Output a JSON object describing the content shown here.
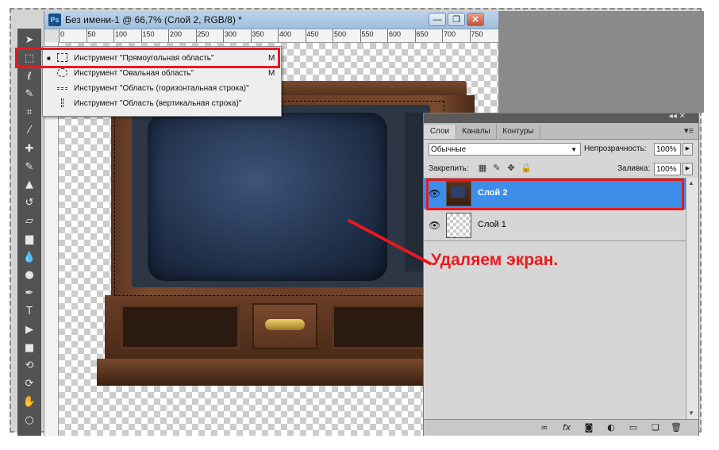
{
  "document": {
    "ps_logo": "Ps",
    "title": "Без имени-1 @ 66,7% (Слой 2, RGB/8) *",
    "ruler_labels": [
      "0",
      "50",
      "100",
      "150",
      "200",
      "250",
      "300",
      "350",
      "400",
      "450",
      "500",
      "550",
      "600",
      "650",
      "700",
      "750"
    ],
    "buttons": {
      "minimize": "—",
      "restore": "❐",
      "close": "✕"
    }
  },
  "flyout": {
    "items": [
      {
        "label": "Инструмент \"Прямоугольная область\"",
        "key": "M",
        "icon": "rect-marquee-icon",
        "active": true
      },
      {
        "label": "Инструмент \"Овальная область\"",
        "key": "M",
        "icon": "ellipse-marquee-icon",
        "active": false
      },
      {
        "label": "Инструмент \"Область (горизонтальная строка)\"",
        "key": "",
        "icon": "single-row-marquee-icon",
        "active": false
      },
      {
        "label": "Инструмент \"Область (вертикальная строка)\"",
        "key": "",
        "icon": "single-column-marquee-icon",
        "active": false
      }
    ]
  },
  "tools": [
    {
      "name": "move-tool-icon",
      "glyph": "➤"
    },
    {
      "name": "marquee-tool-icon",
      "glyph": "⬚"
    },
    {
      "name": "lasso-tool-icon",
      "glyph": "ℓ"
    },
    {
      "name": "quick-selection-tool-icon",
      "glyph": "✎"
    },
    {
      "name": "crop-tool-icon",
      "glyph": "⌗"
    },
    {
      "name": "eyedropper-tool-icon",
      "glyph": "⁄"
    },
    {
      "name": "healing-brush-tool-icon",
      "glyph": "✚"
    },
    {
      "name": "brush-tool-icon",
      "glyph": "✎"
    },
    {
      "name": "clone-stamp-tool-icon",
      "glyph": "▲"
    },
    {
      "name": "history-brush-tool-icon",
      "glyph": "↺"
    },
    {
      "name": "eraser-tool-icon",
      "glyph": "▱"
    },
    {
      "name": "gradient-tool-icon",
      "glyph": "▆"
    },
    {
      "name": "blur-tool-icon",
      "glyph": "💧"
    },
    {
      "name": "dodge-tool-icon",
      "glyph": "●"
    },
    {
      "name": "pen-tool-icon",
      "glyph": "✒"
    },
    {
      "name": "type-tool-icon",
      "glyph": "T"
    },
    {
      "name": "path-selection-tool-icon",
      "glyph": "▶"
    },
    {
      "name": "shape-tool-icon",
      "glyph": "■"
    },
    {
      "name": "3d-rotate-tool-icon",
      "glyph": "⟲"
    },
    {
      "name": "3d-orbit-tool-icon",
      "glyph": "⟳"
    },
    {
      "name": "hand-tool-icon",
      "glyph": "✋"
    },
    {
      "name": "zoom-tool-icon",
      "glyph": "○"
    }
  ],
  "layers_panel": {
    "tabs": [
      "Слои",
      "Каналы",
      "Контуры"
    ],
    "active_tab": "Слои",
    "blend_mode": "Обычные",
    "opacity_label": "Непрозрачность:",
    "opacity_value": "100%",
    "lock_label": "Закрепить:",
    "fill_label": "Заливка:",
    "fill_value": "100%",
    "layers": [
      {
        "name": "Слой 2",
        "selected": true,
        "visible": true
      },
      {
        "name": "Слой 1",
        "selected": false,
        "visible": true
      }
    ],
    "bottom_icons": [
      "link-icon",
      "fx-icon",
      "mask-icon",
      "adjustment-icon",
      "group-folder-icon",
      "new-layer-icon",
      "trash-icon"
    ],
    "fx_label": "fx"
  },
  "annotation": {
    "text": "Удаляем экран.",
    "color": "#e8191f"
  },
  "colors": {
    "selection_blue": "#3d8ee8",
    "annotation_red": "#e8191f",
    "tool_panel": "#535353"
  }
}
